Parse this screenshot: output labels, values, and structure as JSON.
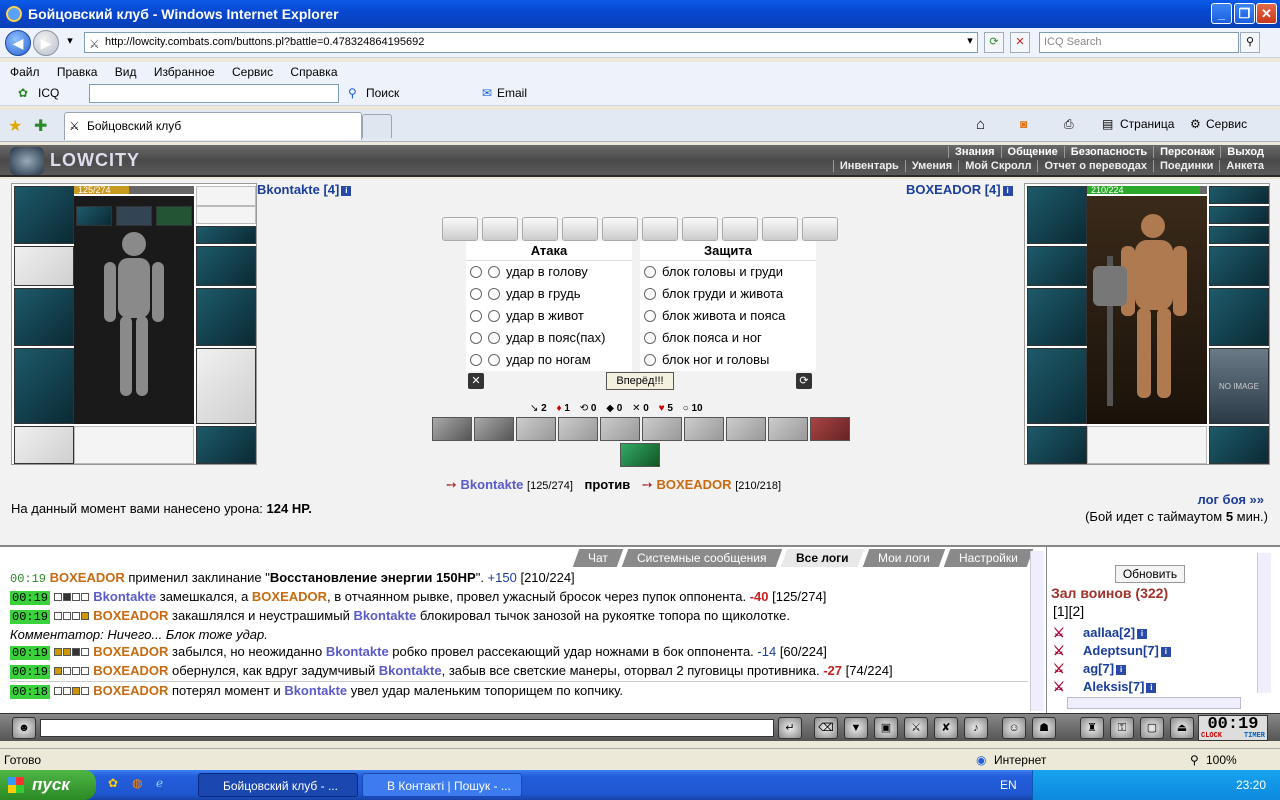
{
  "window": {
    "title": "Бойцовский клуб - Windows Internet Explorer"
  },
  "address": {
    "url": "http://lowcity.combats.com/buttons.pl?battle=0.478324864195692",
    "search_placeholder": "ICQ Search"
  },
  "menu": [
    "Файл",
    "Правка",
    "Вид",
    "Избранное",
    "Сервис",
    "Справка"
  ],
  "toolbar": {
    "icq": "ICQ",
    "search": "Поиск",
    "email": "Email"
  },
  "tabs": {
    "active": "Бойцовский клуб",
    "page": "Страница",
    "service": "Сервис"
  },
  "game": {
    "logo": "LOWCITY",
    "nav_top": [
      "Знания",
      "Общение",
      "Безопасность",
      "Персонаж",
      "Выход"
    ],
    "nav_bottom": [
      "Инвентарь",
      "Умения",
      "Мой Скролл",
      "Отчет о переводах",
      "Поединки",
      "Анкета"
    ],
    "left_player": {
      "name": "Bkontakte [4]",
      "hp": "125/274",
      "hp_fraction": 0.456
    },
    "right_player": {
      "name": "BOXEADOR [4]",
      "hp": "210/224",
      "hp_fraction": 0.9375,
      "noimage": "NO IMAGE"
    },
    "attack_title": "Атака",
    "defense_title": "Защита",
    "attacks": [
      "удар в голову",
      "удар в грудь",
      "удар в живот",
      "удар в пояс(пах)",
      "удар по ногам"
    ],
    "defenses": [
      "блок головы и груди",
      "блок груди и живота",
      "блок живота и пояса",
      "блок пояса и ног",
      "блок ног и головы"
    ],
    "go_button": "Вперёд!!!",
    "stats": [
      "2",
      "1",
      "0",
      "0",
      "0",
      "5",
      "10"
    ],
    "vs": {
      "left": "Bkontakte",
      "left_hp": "[125/274]",
      "word": "против",
      "right": "BOXEADOR",
      "right_hp": "[210/218]"
    },
    "damage_prefix": "На данный момент вами нанесено урона:",
    "damage_value": "124 HP.",
    "log_link": "лог боя »»",
    "timeout_prefix": "(Бой идет с таймаутом",
    "timeout_value": "5",
    "timeout_suffix": "мин.)"
  },
  "log": {
    "tabs": [
      "Чат",
      "Системные сообщения",
      "Все логи",
      "Мои логи",
      "Настройки"
    ],
    "active_tab": "Все логи"
  },
  "side": {
    "refresh": "Обновить",
    "hall": "Зал воинов (322)",
    "pages": "[1][2]",
    "players": [
      "aallaa[2]",
      "Adeptsun[7]",
      "ag[7]",
      "Aleksis[7]"
    ]
  },
  "clock": {
    "time": "00:19",
    "label_left": "CLOCK",
    "label_right": "TIMER"
  },
  "status": {
    "text": "Готово",
    "zone": "Интернет",
    "zoom": "100%"
  },
  "taskbar": {
    "start": "пуск",
    "tasks": [
      "Бойцовский клуб - ...",
      "В Контакті | Пошук - ..."
    ],
    "lang": "EN",
    "time": "23:20"
  }
}
